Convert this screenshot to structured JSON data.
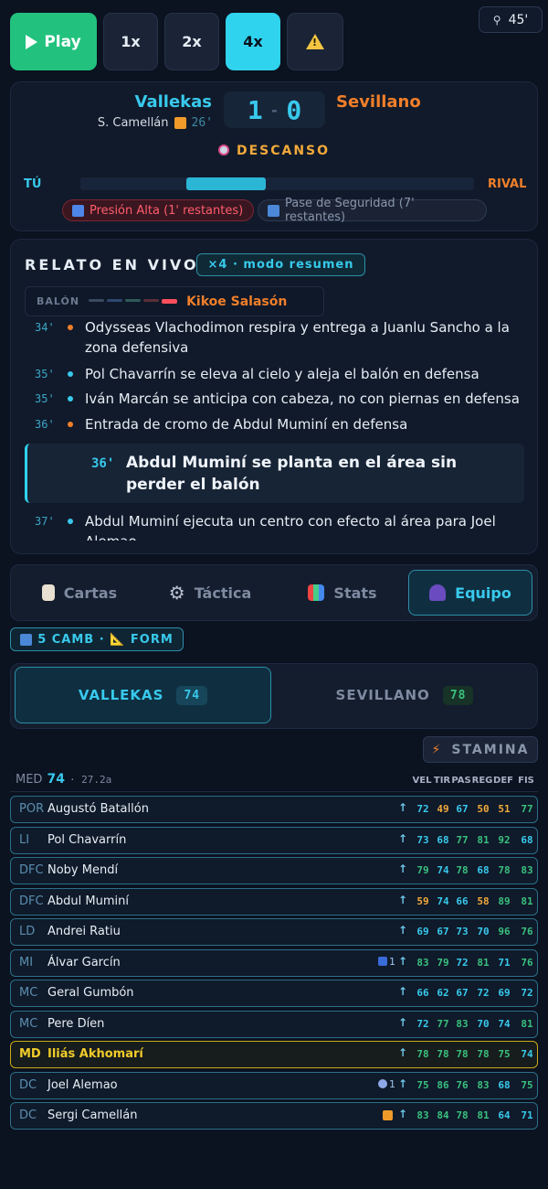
{
  "controls": {
    "play_label": "Play",
    "speed1": "1x",
    "speed2": "2x",
    "speed4": "4x",
    "warn_icon": "warning-icon"
  },
  "minute": "45'",
  "match": {
    "home": "Vallekas",
    "away": "Sevillano",
    "home_score": "1",
    "away_score": "0",
    "scorer": "S. Camellán",
    "scorer_minute": "26'",
    "status": "DESCANSO",
    "you_label": "TÚ",
    "rival_label": "RIVAL",
    "possession_home_fraction": 0.4,
    "chips": [
      "Presión Alta (1' restantes)",
      "Pase de Seguridad (7' restantes)"
    ]
  },
  "relato": {
    "title": "RELATO EN VIVO",
    "badge": "×4 · modo resumen",
    "ball_label": "BALÓN",
    "ball_holder": "Kikoe Salasón",
    "events": [
      {
        "min": "34'",
        "text": "Odysseas Vlachodimon respira y entrega a Juanlu Sancho a la zona defensiva",
        "dot": "#f07f2a"
      },
      {
        "min": "35'",
        "text": "Pol Chavarrín se eleva al cielo y aleja el balón en defensa",
        "dot": "#38c9ec"
      },
      {
        "min": "35'",
        "text": "Iván Marcán se anticipa con cabeza, no con piernas en defensa",
        "dot": "#38c9ec"
      },
      {
        "min": "36'",
        "text": "Entrada de cromo de Abdul Muminí en defensa",
        "dot": "#f07f2a"
      },
      {
        "min": "37'",
        "text": "Abdul Muminí ejecuta un centro con efecto al área para Joel Alemao",
        "dot": "#38c9ec"
      }
    ],
    "highlight": {
      "min": "36'",
      "text": "Abdul Muminí se planta en el área sin perder el balón"
    }
  },
  "tabs": [
    "Cartas",
    "Táctica",
    "Stats",
    "Equipo"
  ],
  "subs_badge": "5 CAMB · 📐 FORM",
  "team_select": {
    "home": "VALLEKAS",
    "home_ovr": "74",
    "away": "SEVILLANO",
    "away_ovr": "78"
  },
  "stamina_label": "STAMINA",
  "summary": {
    "label": "MED",
    "value": "74",
    "age": "· 27.2a"
  },
  "stat_headers": [
    "VEL",
    "TIR",
    "PAS",
    "REG",
    "DEF",
    "FIS"
  ],
  "players": [
    {
      "pos": "POR",
      "name": "Augustó Batallón",
      "stats": [
        "72",
        "49",
        "67",
        "50",
        "51",
        "77"
      ]
    },
    {
      "pos": "LI",
      "name": "Pol Chavarrín",
      "stats": [
        "73",
        "68",
        "77",
        "81",
        "92",
        "68"
      ]
    },
    {
      "pos": "DFC",
      "name": "Noby Mendí",
      "stats": [
        "79",
        "74",
        "78",
        "68",
        "78",
        "83"
      ]
    },
    {
      "pos": "DFC",
      "name": "Abdul Muminí",
      "stats": [
        "59",
        "74",
        "66",
        "58",
        "89",
        "81"
      ]
    },
    {
      "pos": "LD",
      "name": "Andrei Ratiu",
      "stats": [
        "69",
        "67",
        "73",
        "70",
        "96",
        "76"
      ]
    },
    {
      "pos": "MI",
      "name": "Álvar Garcín",
      "stats": [
        "83",
        "79",
        "72",
        "81",
        "71",
        "76"
      ],
      "extra": "1"
    },
    {
      "pos": "MC",
      "name": "Geral Gumbón",
      "stats": [
        "66",
        "62",
        "67",
        "72",
        "69",
        "72"
      ]
    },
    {
      "pos": "MC",
      "name": "Pere Díen",
      "stats": [
        "72",
        "77",
        "83",
        "70",
        "74",
        "81"
      ]
    },
    {
      "pos": "MD",
      "name": "Iliás Akhomarí",
      "stats": [
        "78",
        "78",
        "78",
        "78",
        "75",
        "74"
      ],
      "active": true
    },
    {
      "pos": "DC",
      "name": "Joel Alemao",
      "stats": [
        "75",
        "86",
        "76",
        "83",
        "68",
        "75"
      ],
      "extra": "1"
    },
    {
      "pos": "DC",
      "name": "Sergi Camellán",
      "stats": [
        "83",
        "84",
        "78",
        "81",
        "64",
        "71"
      ]
    }
  ]
}
